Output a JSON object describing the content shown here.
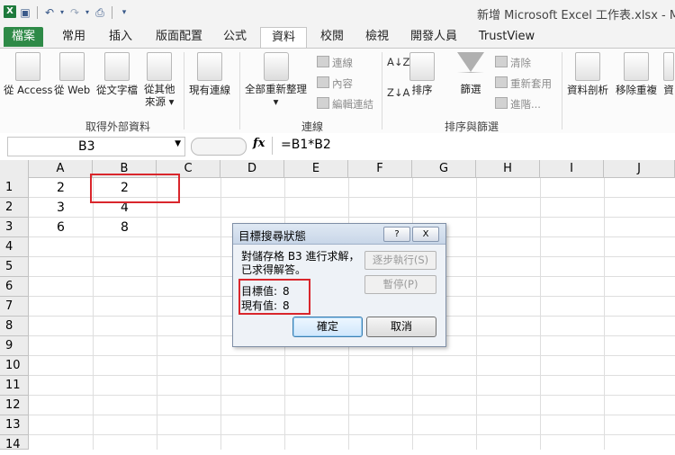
{
  "window": {
    "title": "新增 Microsoft Excel 工作表.xlsx - Mic",
    "app_icon": "X",
    "qat_icons": [
      "save-icon",
      "undo-icon",
      "redo-icon",
      "print-preview-icon"
    ]
  },
  "tabs": [
    "檔案",
    "常用",
    "插入",
    "版面配置",
    "公式",
    "資料",
    "校閱",
    "檢視",
    "開發人員",
    "TrustView"
  ],
  "active_tab": "資料",
  "ribbon": {
    "get_external": {
      "label": "取得外部資料",
      "items": [
        "從 Access",
        "從 Web",
        "從文字檔",
        "從其他",
        "來源",
        "現有連線"
      ]
    },
    "connections": {
      "label": "連線",
      "refresh_line1": "全部重新整理",
      "small": [
        "連線",
        "內容",
        "編輯連結"
      ]
    },
    "sort_filter": {
      "label": "排序與篩選",
      "sort": "排序",
      "filter": "篩選",
      "small": [
        "清除",
        "重新套用",
        "進階..."
      ]
    },
    "data_tools": {
      "text_to_columns": "資料剖析",
      "remove_dupes": "移除重複",
      "partial": "資"
    }
  },
  "formula_bar": {
    "name_box": "B3",
    "fx": "fx",
    "formula": "=B1*B2"
  },
  "grid": {
    "columns": [
      "A",
      "B",
      "C",
      "D",
      "E",
      "F",
      "G",
      "H",
      "I",
      "J"
    ],
    "rows": [
      "1",
      "2",
      "3",
      "4",
      "5",
      "6",
      "7",
      "8",
      "9",
      "10",
      "11",
      "12",
      "13",
      "14"
    ],
    "cells": {
      "A1": "2",
      "B1": "2",
      "A2": "3",
      "B2": "4",
      "A3": "6",
      "B3": "8"
    },
    "highlight_color": "#d9262c"
  },
  "dialog": {
    "title": "目標搜尋狀態",
    "help_btn": "?",
    "close_btn": "X",
    "msg_line1": "對儲存格 B3 進行求解，",
    "msg_line2": "已求得解答。",
    "target_label": "目標值:",
    "target_value": "8",
    "current_label": "現有值:",
    "current_value": "8",
    "step_button": "逐步執行(S)",
    "pause_button": "暫停(P)",
    "ok_button": "確定",
    "cancel_button": "取消"
  }
}
